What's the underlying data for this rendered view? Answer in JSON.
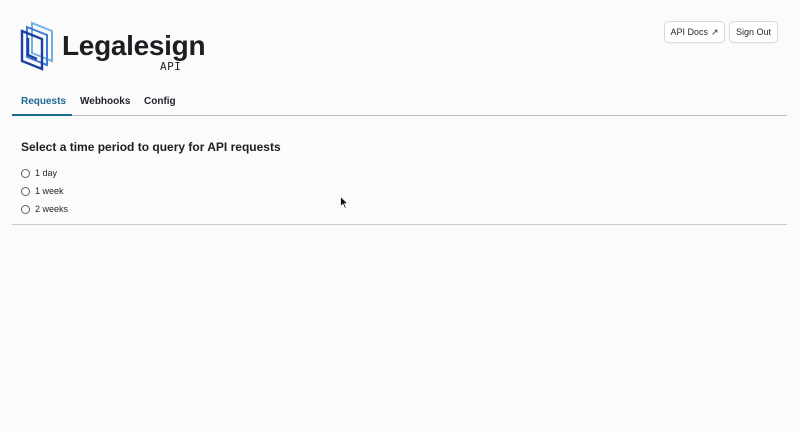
{
  "brand": {
    "name": "Legalesign",
    "sub": "API",
    "logo_color_dark": "#1c3fa3",
    "logo_color_light": "#6fb0e6"
  },
  "header": {
    "docs_label": "API Docs",
    "docs_icon": "external-arrow-icon",
    "signout_label": "Sign Out"
  },
  "tabs": [
    {
      "label": "Requests",
      "active": true
    },
    {
      "label": "Webhooks",
      "active": false
    },
    {
      "label": "Config",
      "active": false
    }
  ],
  "accent_color": "#1a6a8e",
  "main": {
    "title": "Select a time period to query for API requests",
    "options": [
      {
        "label": "1 day",
        "selected": false
      },
      {
        "label": "1 week",
        "selected": false
      },
      {
        "label": "2 weeks",
        "selected": false
      }
    ]
  }
}
